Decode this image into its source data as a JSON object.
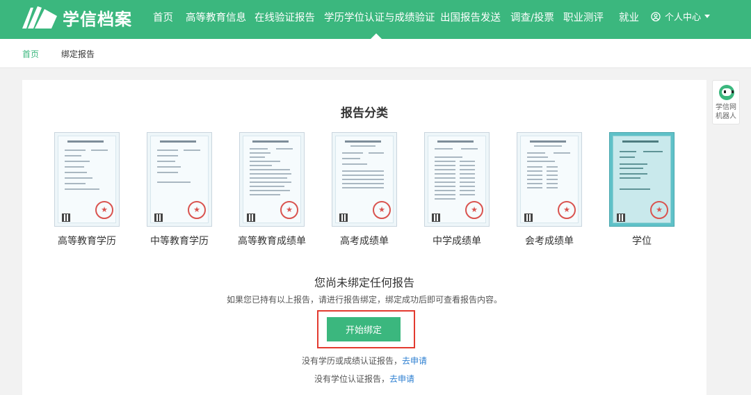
{
  "brand": {
    "logo_text": "学信档案",
    "primary_color": "#3bb77e",
    "logo_icon": "book-logo-icon"
  },
  "nav": {
    "items": [
      "首页",
      "高等教育信息",
      "在线验证报告",
      "学历学位认证与成绩验证",
      "出国报告发送",
      "调查/投票",
      "职业测评",
      "就业"
    ],
    "active": "学历学位认证与成绩验证",
    "user_menu": "个人中心"
  },
  "breadcrumb": {
    "home": "首页",
    "current": "绑定报告"
  },
  "main": {
    "section_title": "报告分类",
    "reports": [
      {
        "label": "高等教育学历"
      },
      {
        "label": "中等教育学历"
      },
      {
        "label": "高等教育成绩单"
      },
      {
        "label": "高考成绩单"
      },
      {
        "label": "中学成绩单"
      },
      {
        "label": "会考成绩单"
      },
      {
        "label": "学位"
      }
    ],
    "empty_title": "您尚未绑定任何报告",
    "hint": "如果您已持有以上报告，请进行报告绑定，绑定成功后即可查看报告内容。",
    "bind_button": "开始绑定",
    "no_degree_report": "没有学历或成绩认证报告，",
    "no_degree_link": "去申请",
    "no_academic_report": "没有学位认证报告，",
    "no_academic_link": "去申请"
  },
  "robot": {
    "label_line1": "学信网",
    "label_line2": "机器人"
  }
}
